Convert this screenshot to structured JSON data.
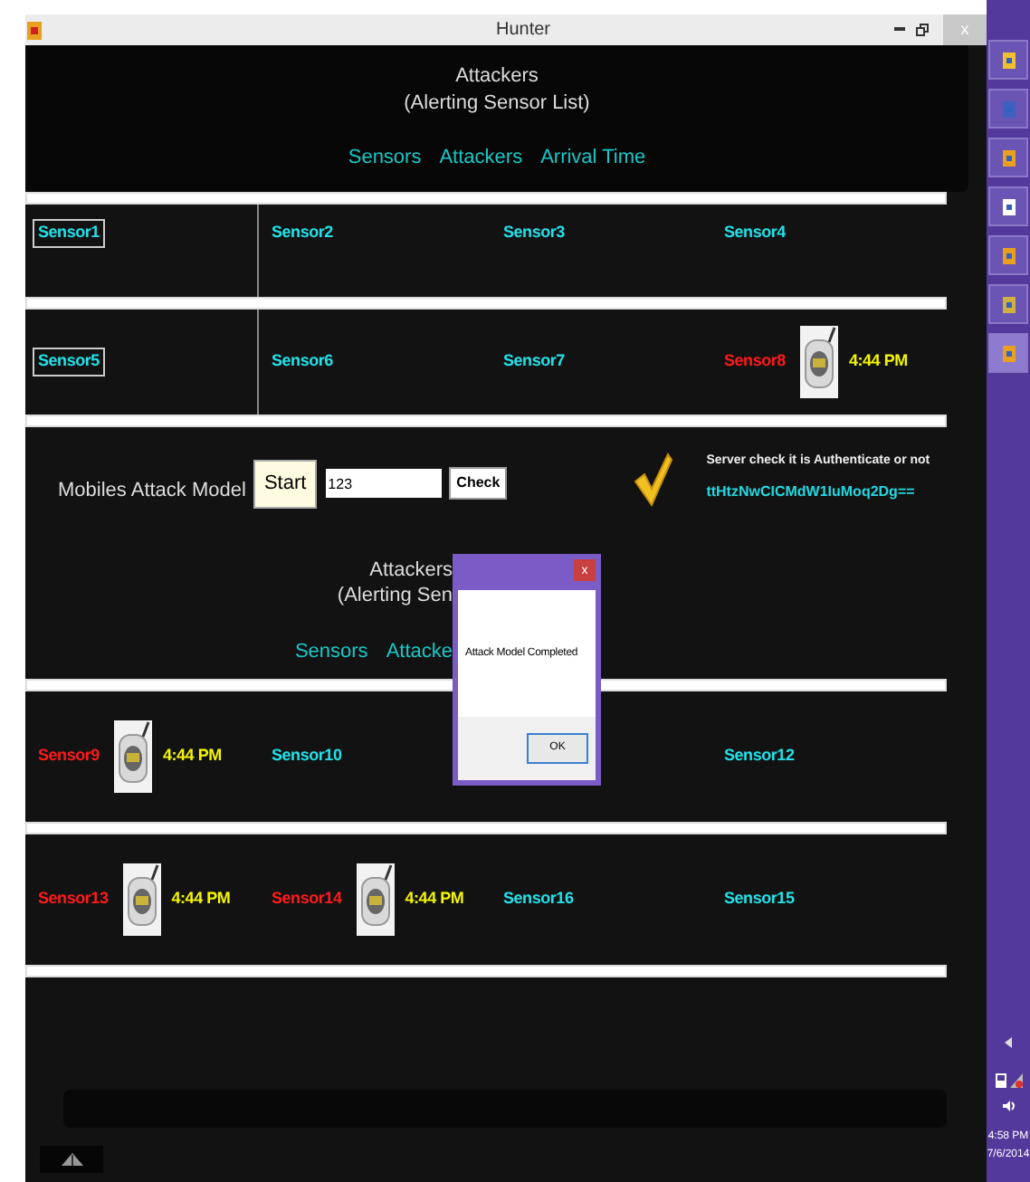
{
  "window": {
    "title": "Hunter",
    "close": "x"
  },
  "top_panel": {
    "title": "Attackers",
    "subtitle": "(Alerting Sensor List)",
    "headers": [
      "Sensors",
      "Attackers",
      "Arrival Time"
    ]
  },
  "top_grid": [
    {
      "column_1": {
        "label": "Sensor1",
        "alert": false,
        "selected": true
      },
      "column_2": {
        "label": "Sensor2",
        "alert": false,
        "selected": false
      },
      "column_3": {
        "label": "Sensor3",
        "alert": false,
        "selected": false
      },
      "column_4": {
        "label": "Sensor4",
        "alert": false,
        "selected": false
      }
    },
    {
      "column_1": {
        "label": "Sensor5",
        "alert": false,
        "selected": true
      },
      "column_2": {
        "label": "Sensor6",
        "alert": false,
        "selected": false
      },
      "column_3": {
        "label": "Sensor7",
        "alert": false,
        "selected": false
      },
      "column_4": {
        "label": "Sensor8",
        "alert": true,
        "time": "4:44 PM",
        "selected": false
      }
    }
  ],
  "attack_model": {
    "label": "Mobiles Attack Model",
    "start_button": "Start",
    "input_value": "123",
    "check_button": "Check",
    "server_label": "Server check it is Authenticate or not",
    "server_hash": "ttHtzNwCICMdW1IuMoq2Dg=="
  },
  "second_panel": {
    "title": "Attackers",
    "subtitle": "(Alerting Sen",
    "headers": [
      "Sensors",
      "Attacke"
    ]
  },
  "bottom_grid": [
    {
      "column_1": {
        "label": "Sensor9",
        "alert": true,
        "time": "4:44 PM",
        "selected": false
      },
      "column_2": {
        "label": "Sensor10",
        "alert": false,
        "selected": false
      },
      "column_4": {
        "label": "Sensor12",
        "alert": false,
        "selected": false
      }
    },
    {
      "column_1": {
        "label": "Sensor13",
        "alert": true,
        "time": "4:44 PM",
        "selected": false
      },
      "column_2": {
        "label": "Sensor14",
        "alert": true,
        "time": "4:44 PM",
        "selected": false
      },
      "column_3": {
        "label": "Sensor16",
        "alert": false,
        "selected": false
      },
      "column_4": {
        "label": "Sensor15",
        "alert": false,
        "selected": false
      }
    }
  ],
  "dialog": {
    "close": "x",
    "message": "Attack Model Completed",
    "ok_button": "OK"
  },
  "taskbar": {
    "time": "4:58 PM",
    "date": "7/6/2014"
  }
}
